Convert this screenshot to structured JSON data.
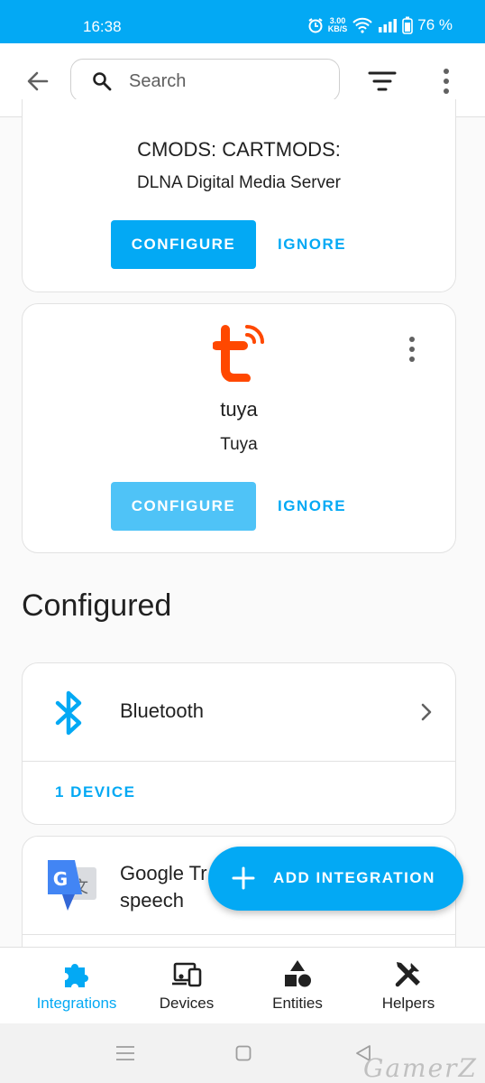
{
  "status_bar": {
    "time": "16:38",
    "speed_value": "3.00",
    "speed_unit": "KB/S",
    "battery": "76 %"
  },
  "app_bar": {
    "search_placeholder": "Search"
  },
  "discovered": [
    {
      "title": "CMODS: CARTMODS:",
      "subtitle": "DLNA Digital Media Server",
      "configure_label": "CONFIGURE",
      "ignore_label": "IGNORE"
    },
    {
      "title": "tuya",
      "subtitle": "Tuya",
      "configure_label": "CONFIGURE",
      "ignore_label": "IGNORE",
      "icon": "tuya-logo-icon"
    }
  ],
  "configured_section": {
    "title": "Configured"
  },
  "configured": [
    {
      "name": "Bluetooth",
      "link_label": "1 DEVICE",
      "icon": "bluetooth-icon"
    },
    {
      "name_line1": "Google Tr",
      "name_line2": "speech",
      "icon": "google-translate-icon"
    }
  ],
  "fab": {
    "label": "ADD INTEGRATION"
  },
  "bottom_nav": [
    {
      "label": "Integrations",
      "icon": "puzzle-icon",
      "active": true
    },
    {
      "label": "Devices",
      "icon": "devices-icon",
      "active": false
    },
    {
      "label": "Entities",
      "icon": "shapes-icon",
      "active": false
    },
    {
      "label": "Helpers",
      "icon": "tools-icon",
      "active": false
    }
  ],
  "watermark": "GamerZ",
  "colors": {
    "accent": "#03a9f4",
    "accent_light": "#4fc3f7",
    "tuya": "#ff4800",
    "text": "#212121"
  }
}
